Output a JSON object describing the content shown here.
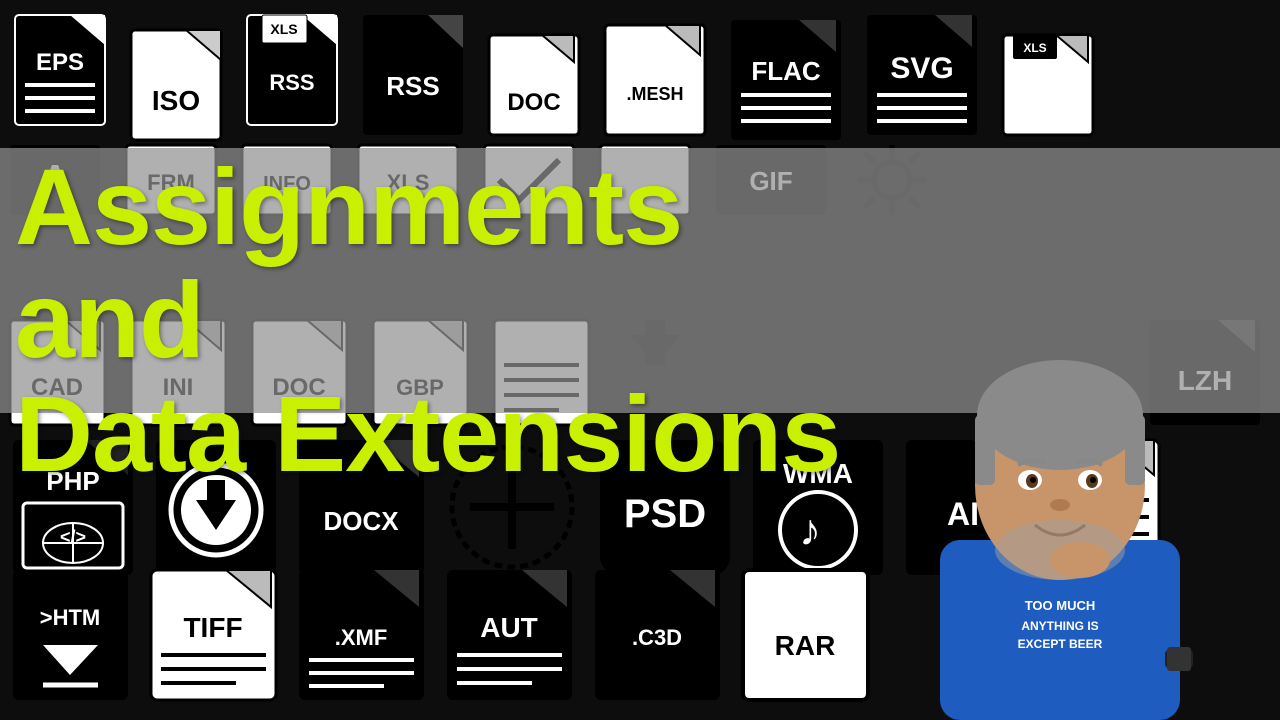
{
  "page": {
    "background_color": "#111111",
    "title_line1": "Assignments and",
    "title_line2": "Data Extensions",
    "title_color": "#c8f000",
    "gray_band_color": "rgba(140,140,140,0.75)"
  },
  "icons_top_row": [
    {
      "label": "EPS",
      "style": "dark"
    },
    {
      "label": "ISO",
      "style": "light"
    },
    {
      "label": "XLS",
      "style": "dark"
    },
    {
      "label": "RSS",
      "style": "dark"
    },
    {
      "label": "DOC",
      "style": "light"
    },
    {
      "label": ".MESH",
      "style": "light"
    },
    {
      "label": "FLAC",
      "style": "dark"
    },
    {
      "label": "SVG",
      "style": "dark"
    },
    {
      "label": "XLS",
      "style": "light"
    }
  ],
  "icons_mid_row": [
    {
      "label": "A",
      "style": "dark"
    },
    {
      "label": "FRM",
      "style": "light"
    },
    {
      "label": "INFO",
      "style": "light"
    },
    {
      "label": "XLS",
      "style": "light"
    },
    {
      "label": "",
      "style": "check"
    },
    {
      "label": "",
      "style": "document"
    },
    {
      "label": "GIF",
      "style": "dark"
    },
    {
      "label": "",
      "style": "sun"
    }
  ],
  "icons_lower_row": [
    {
      "label": "CAD",
      "style": "light"
    },
    {
      "label": "INI",
      "style": "light"
    },
    {
      "label": "DOC",
      "style": "light"
    },
    {
      "label": "GBP",
      "style": "light"
    },
    {
      "label": "",
      "style": "document2"
    },
    {
      "label": "",
      "style": "download"
    },
    {
      "label": "LZH",
      "style": "dark"
    }
  ],
  "icons_bottom_row1": [
    {
      "label": "PHP",
      "style": "php"
    },
    {
      "label": "",
      "style": "download-circle"
    },
    {
      "label": "DOCX",
      "style": "dark"
    },
    {
      "label": "+",
      "style": "circle-plus"
    },
    {
      "label": "PSD",
      "style": "rounded"
    },
    {
      "label": "WMA",
      "style": "wma"
    },
    {
      "label": "AI",
      "style": "dark"
    },
    {
      "label": "",
      "style": "document3"
    }
  ],
  "icons_bottom_row2": [
    {
      "label": ">HTM",
      "style": "dark-arrow"
    },
    {
      "label": "TIFF",
      "style": "light"
    },
    {
      "label": ".XMF",
      "style": "dark"
    },
    {
      "label": "AUT",
      "style": "dark"
    },
    {
      "label": ".C3D",
      "style": "dark"
    },
    {
      "label": "RAR",
      "style": "rounded-light"
    }
  ],
  "person": {
    "shirt_text": "TOO MUCH\nANYTHING IS\nEXCEPT BEER",
    "shirt_color": "#1e5cbf"
  }
}
